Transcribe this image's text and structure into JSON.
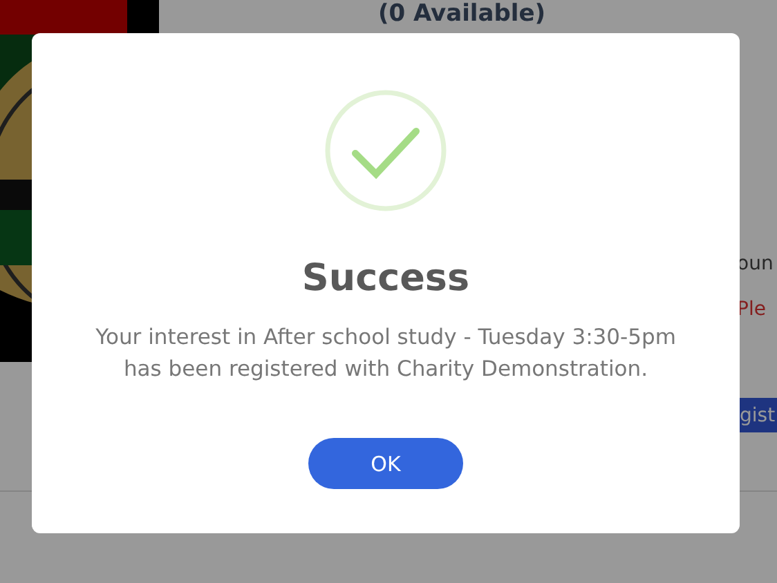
{
  "page": {
    "availability": "(0 Available)",
    "fragment_1": "oun",
    "warning_fragment": "Ple",
    "register_button": "gist"
  },
  "dialog": {
    "title": "Success",
    "message": "Your interest in After school study - Tuesday 3:30-5pm has been registered with Charity Demonstration.",
    "button": "OK"
  }
}
